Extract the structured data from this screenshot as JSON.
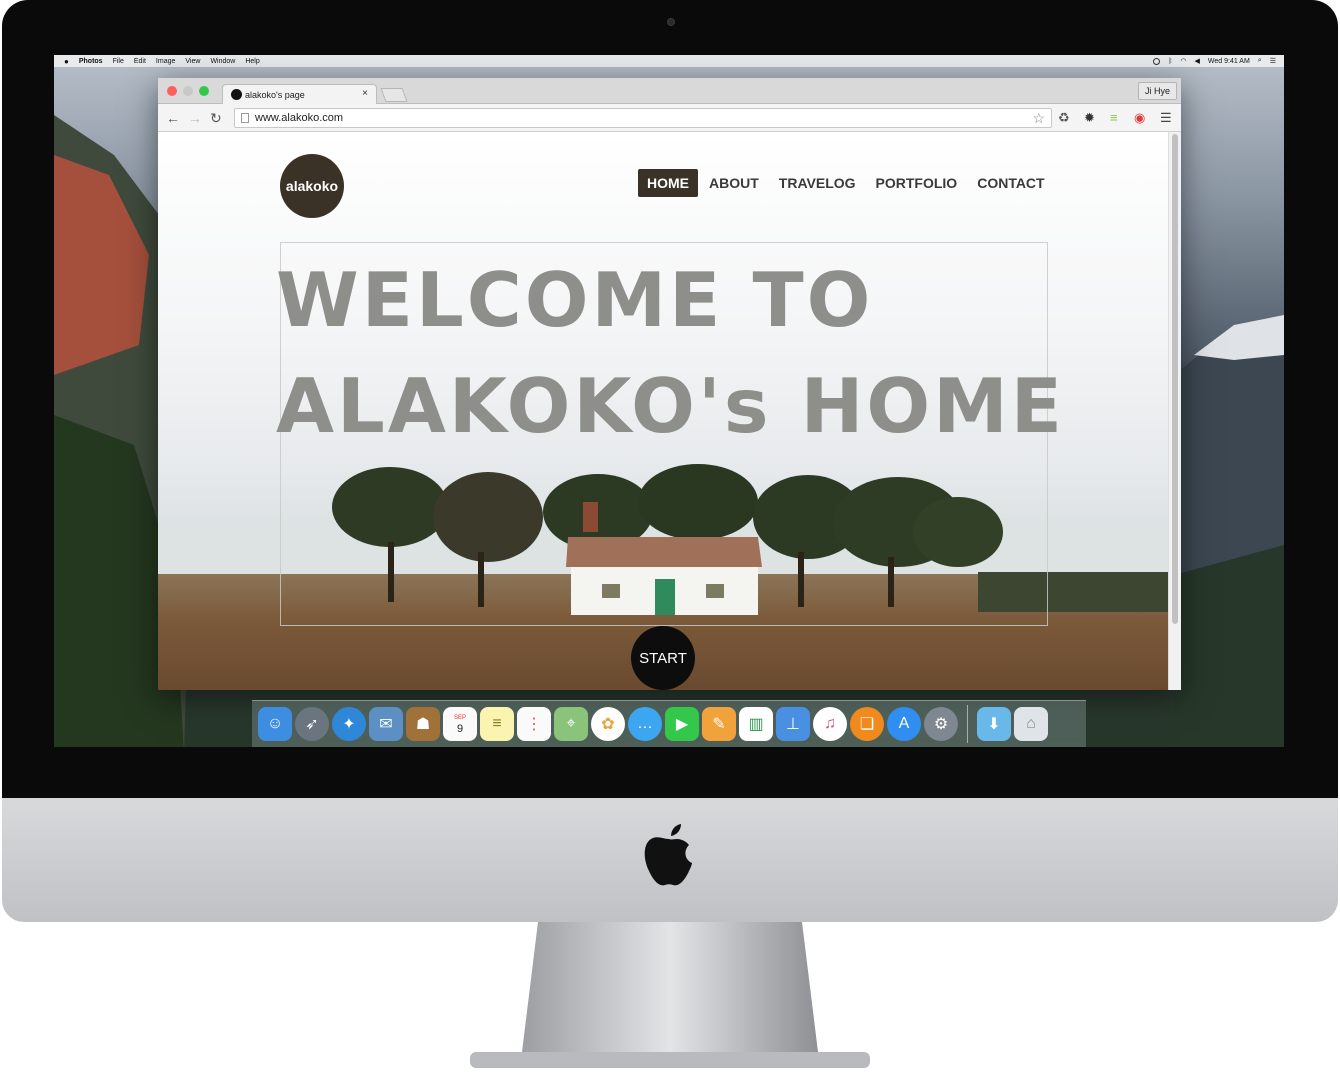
{
  "menubar": {
    "app": "Photos",
    "items": [
      "File",
      "Edit",
      "Image",
      "View",
      "Window",
      "Help"
    ],
    "clock": "Wed 9:41 AM"
  },
  "browser": {
    "tab_title": "alakoko's page",
    "tab_close": "×",
    "user": "Ji Hye",
    "url": "www.alakoko.com",
    "back": "←",
    "forward": "→",
    "reload": "↻",
    "star": "☆"
  },
  "site": {
    "logo": "alakoko",
    "nav": [
      "HOME",
      "ABOUT",
      "TRAVELOG",
      "PORTFOLIO",
      "CONTACT"
    ],
    "active_nav": "HOME",
    "hero_line1": "WELCOME TO",
    "hero_line2": "ALAKOKO's HOME",
    "start": "START"
  },
  "dock": {
    "calendar_month": "SEP",
    "calendar_day": "9",
    "icons": [
      "finder-icon",
      "launchpad-icon",
      "safari-icon",
      "mail-icon",
      "contacts-icon",
      "calendar-icon",
      "notes-icon",
      "reminders-icon",
      "maps-icon",
      "photos-icon",
      "messages-icon",
      "facetime-icon",
      "pages-icon",
      "numbers-icon",
      "keynote-icon",
      "itunes-icon",
      "ibooks-icon",
      "app-store-icon",
      "system-preferences-icon",
      "downloads-folder-icon",
      "trash-icon"
    ]
  },
  "colors": {
    "nav_active_bg": "#3a3226",
    "hero_text": "#8e8e8b",
    "start_bg": "#0d0d0d"
  }
}
